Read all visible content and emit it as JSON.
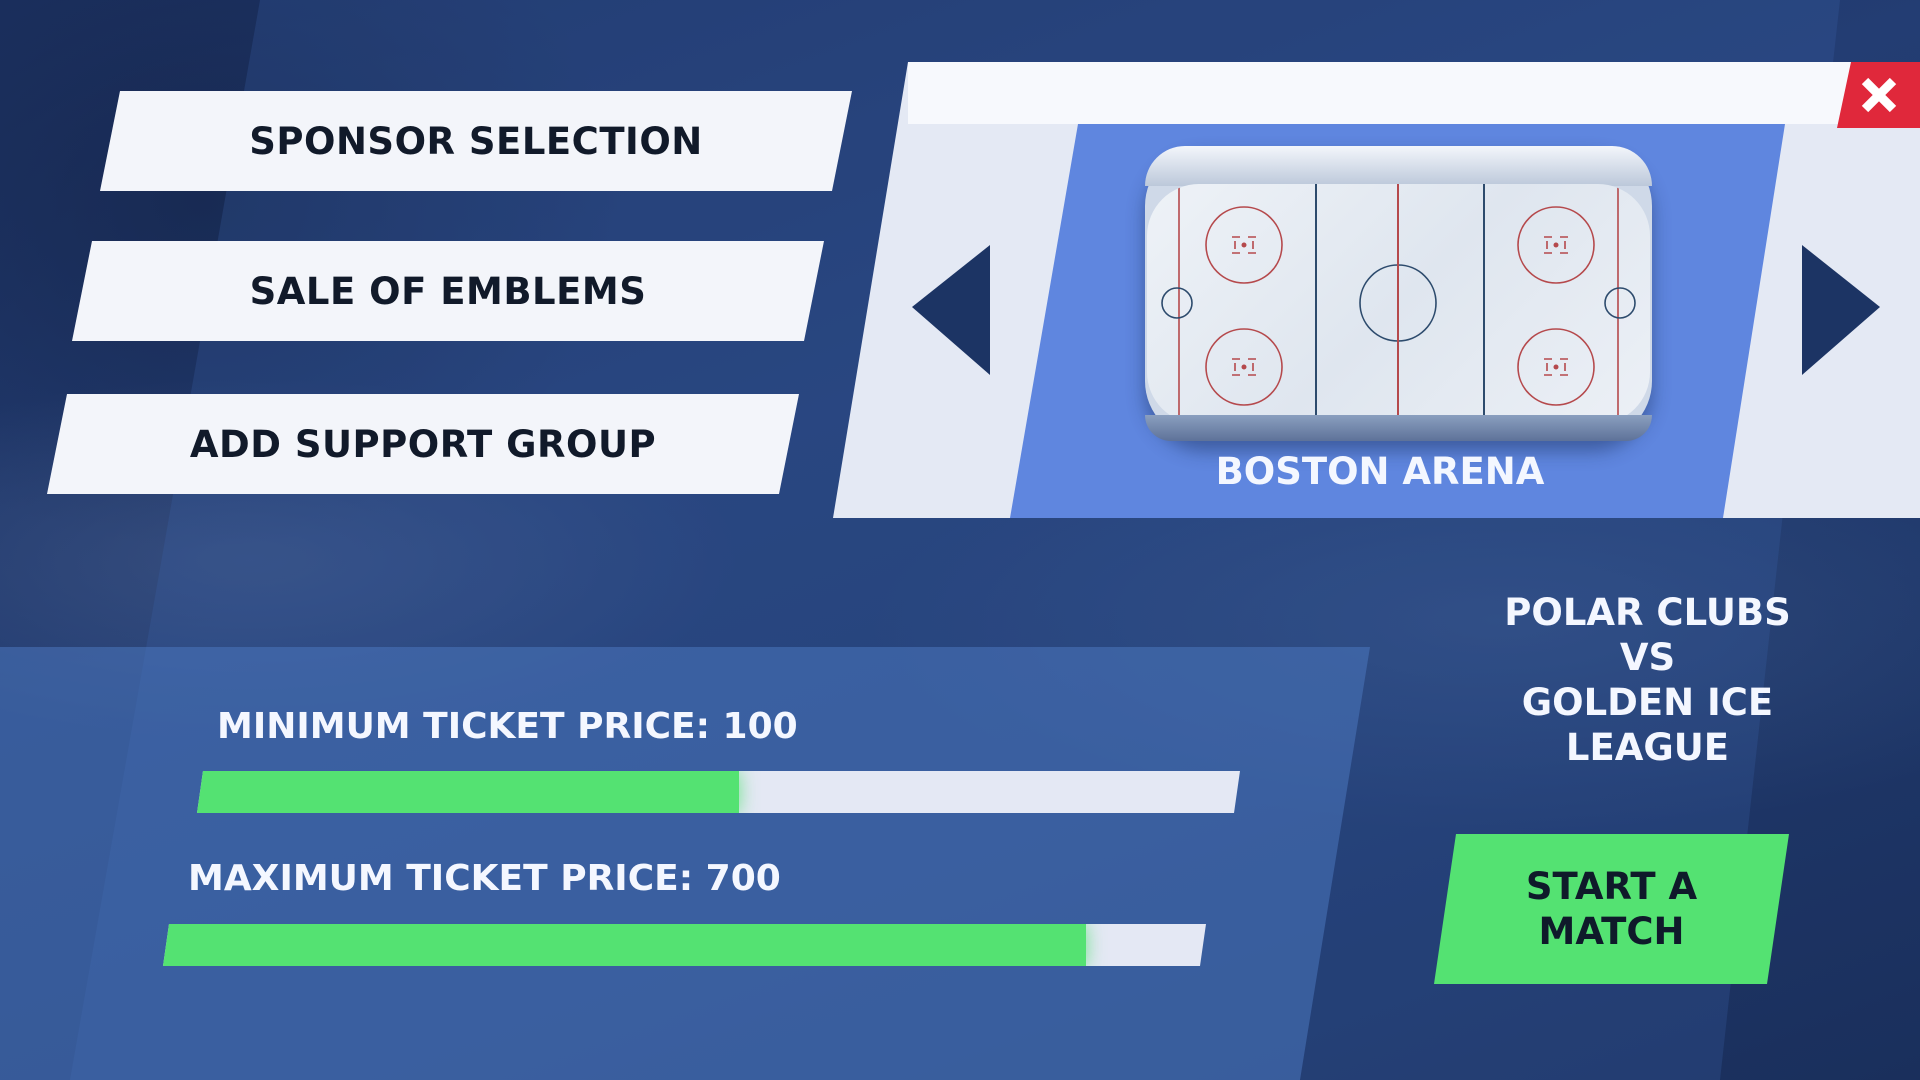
{
  "menu": {
    "sponsor_label": "SPONSOR SELECTION",
    "emblems_label": "SALE OF EMBLEMS",
    "support_label": "ADD SUPPORT GROUP"
  },
  "arena": {
    "name": "BOSTON ARENA",
    "prev_icon": "triangle-left-icon",
    "next_icon": "triangle-right-icon",
    "close_icon": "close-x-icon"
  },
  "tickets": {
    "min_label": "MINIMUM TICKET PRICE: 100",
    "min_fill": 0.52,
    "max_label": "MAXIMUM TICKET PRICE: 700",
    "max_fill": 0.885
  },
  "match": {
    "line1": "POLAR CLUBS",
    "line2": "VS",
    "line3": "GOLDEN ICE",
    "line4": "LEAGUE",
    "start_line1": "START A",
    "start_line2": "MATCH"
  },
  "colors": {
    "accent_green": "#54e272",
    "close_red": "#e0283b",
    "arena_blue": "#5f86df",
    "navy": "#1c3464"
  }
}
